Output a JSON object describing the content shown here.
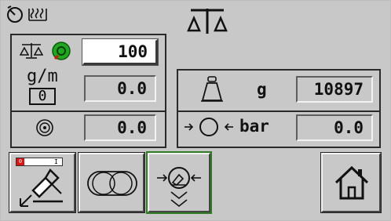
{
  "header": {
    "icons": [
      "timer-icon",
      "heating-icon",
      "balance-scale-icon"
    ]
  },
  "left_panel": {
    "setpoint_value": "100",
    "flow_unit": "g/m",
    "flow_unit_index": "0",
    "flow_value": "0.0",
    "speed_value": "0.0"
  },
  "right_panel": {
    "weight_unit": "g",
    "weight_value": "10897",
    "pressure_unit": "bar",
    "pressure_value": "0.0"
  },
  "toolbar": {
    "buttons": [
      "dispense-mode-button",
      "roller-button",
      "pressure-calibration-button",
      "home-button"
    ],
    "gauge_value": "0",
    "gauge_mark": "I"
  },
  "colors": {
    "background": "#c8c8c8",
    "status_green": "#1ea81e",
    "status_red": "#e01010",
    "active_outline": "#2f7d22"
  }
}
